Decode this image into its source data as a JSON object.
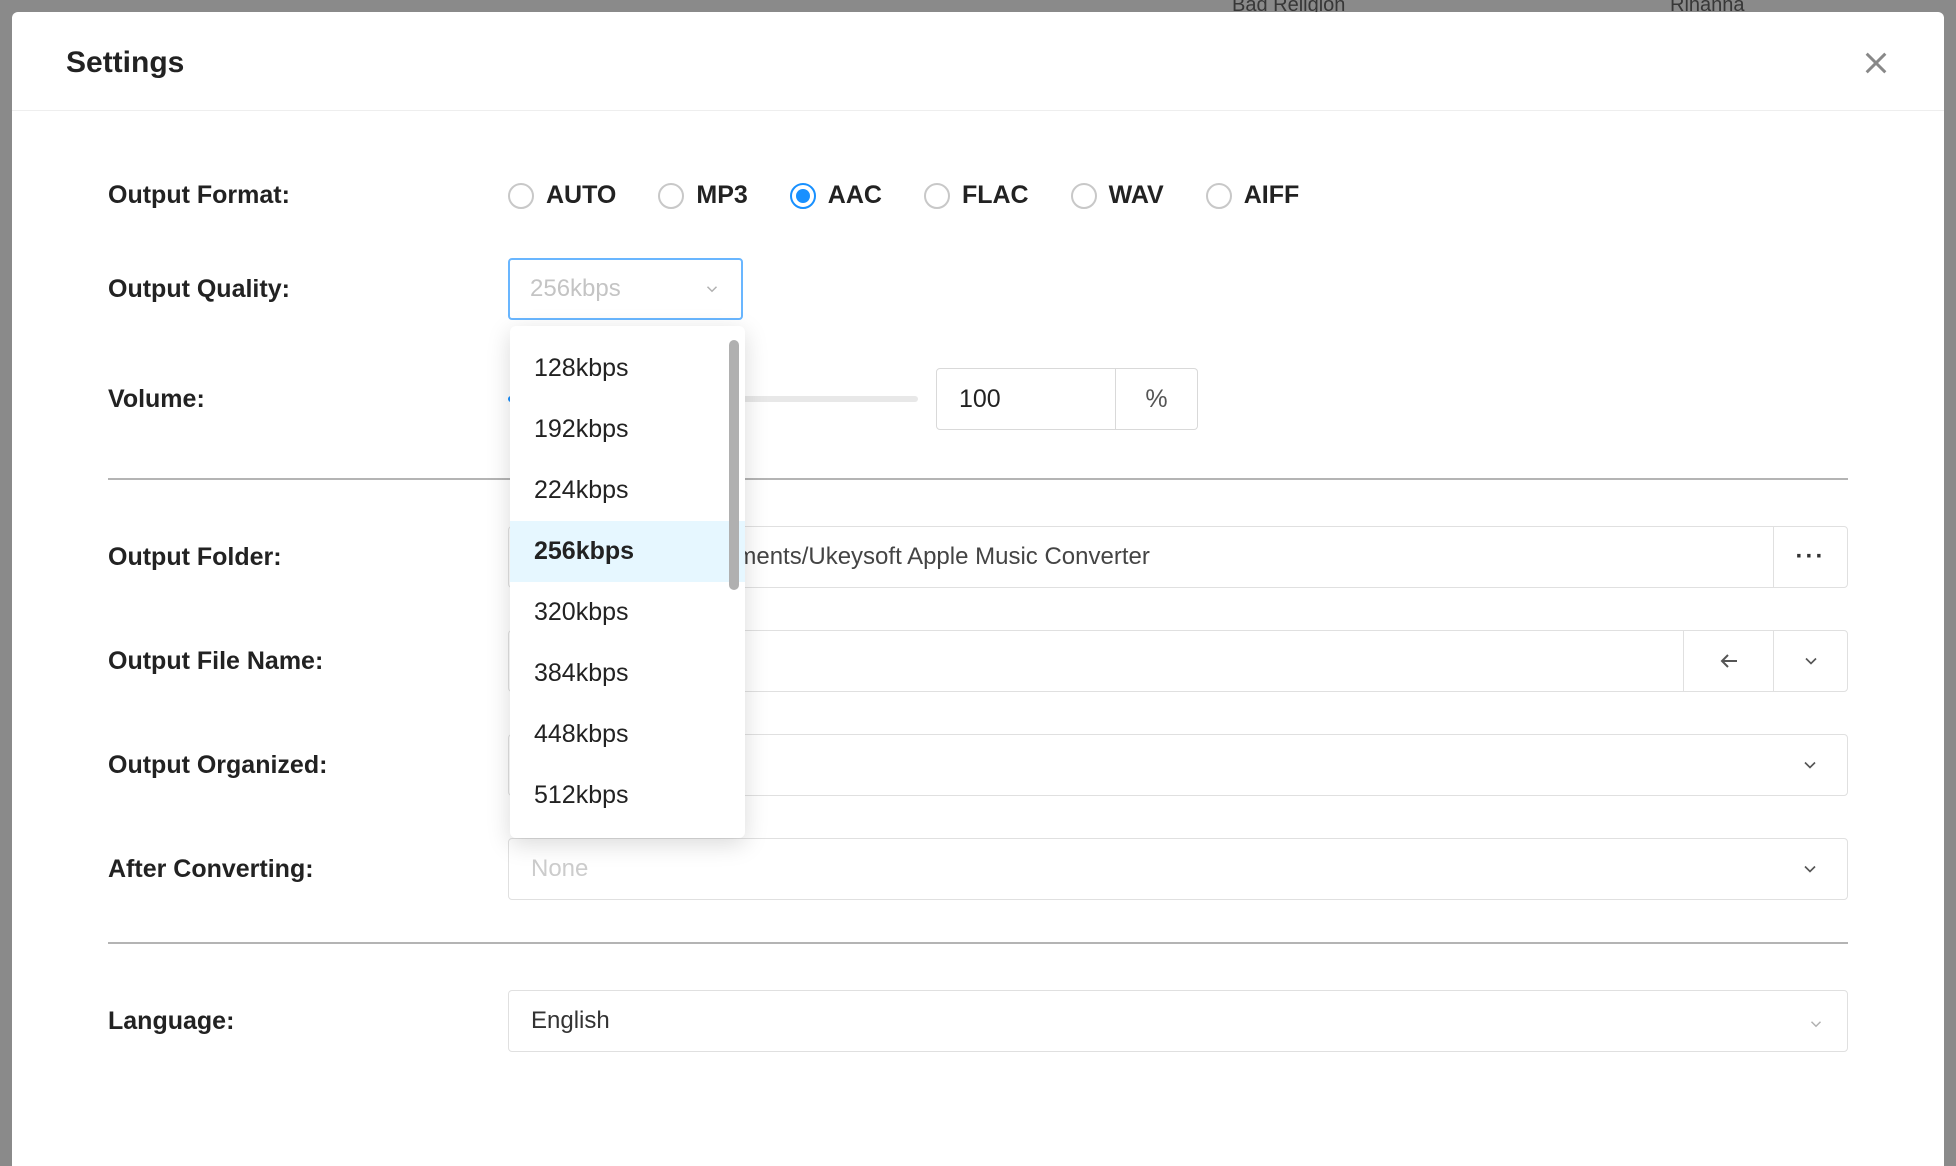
{
  "modal": {
    "title": "Settings"
  },
  "labels": {
    "output_format": "Output Format:",
    "output_quality": "Output Quality:",
    "volume": "Volume:",
    "output_folder": "Output Folder:",
    "output_file_name": "Output File Name:",
    "output_organized": "Output Organized:",
    "after_converting": "After Converting:",
    "language": "Language:"
  },
  "format_options": [
    "AUTO",
    "MP3",
    "AAC",
    "FLAC",
    "WAV",
    "AIFF"
  ],
  "format_selected": "AAC",
  "quality": {
    "placeholder": "256kbps",
    "options": [
      "128kbps",
      "192kbps",
      "224kbps",
      "256kbps",
      "320kbps",
      "384kbps",
      "448kbps",
      "512kbps"
    ],
    "highlighted": "256kbps"
  },
  "volume": {
    "value": "100",
    "unit": "%",
    "percent": 50
  },
  "output_folder_value": "cuments/Ukeysoft Apple Music Converter",
  "output_file_name_value": "",
  "output_organized_value": "",
  "after_converting_value": "None",
  "language_value": "English",
  "bg_text_left": "Bad Religion",
  "bg_text_right": "Rihanna"
}
